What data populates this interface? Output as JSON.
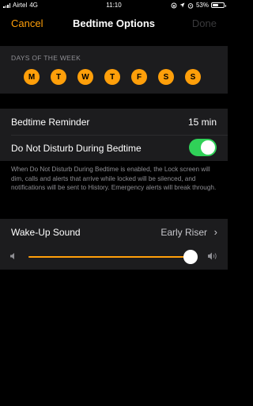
{
  "status_bar": {
    "carrier": "Airtel",
    "network": "4G",
    "time": "11:10",
    "battery_text": "53%",
    "battery_level": 0.53
  },
  "nav": {
    "cancel_label": "Cancel",
    "title": "Bedtime Options",
    "done_label": "Done"
  },
  "days": {
    "header": "DAYS OF THE WEEK",
    "items": [
      "M",
      "T",
      "W",
      "T",
      "F",
      "S",
      "S"
    ]
  },
  "settings": {
    "reminder_label": "Bedtime Reminder",
    "reminder_value": "15 min",
    "dnd_label": "Do Not Disturb During Bedtime",
    "dnd_enabled": true,
    "footnote": "When Do Not Disturb During Bedtime is enabled, the Lock screen will dim, calls and alerts that arrive while locked will be silenced, and notifications will be sent to History. Emergency alerts will break through."
  },
  "wake_up": {
    "label": "Wake-Up Sound",
    "value": "Early Riser",
    "volume": 0.96
  },
  "colors": {
    "accent": "#ff9f0a",
    "toggle_on": "#30d158",
    "background": "#000000",
    "cell": "#1c1c1e"
  }
}
